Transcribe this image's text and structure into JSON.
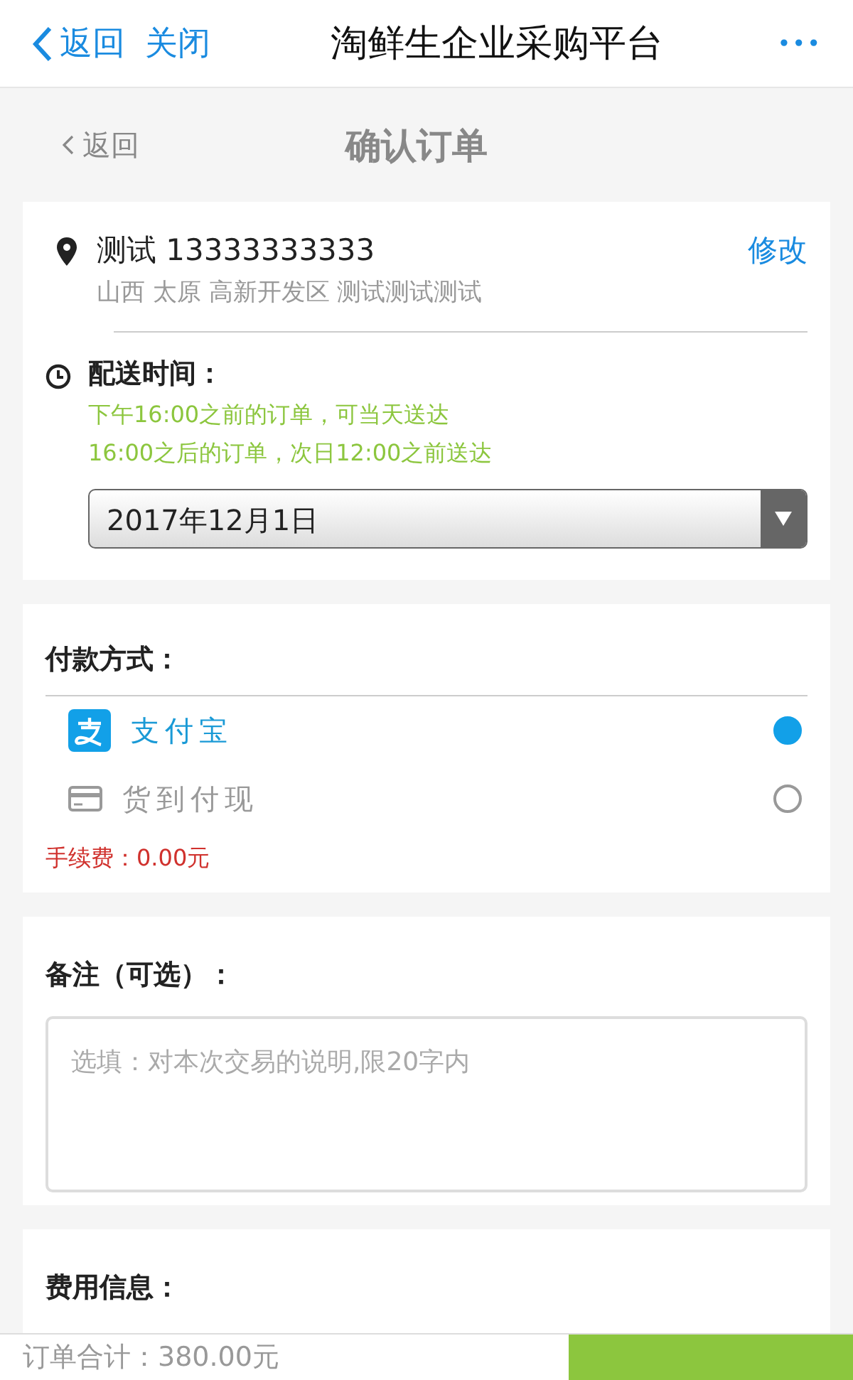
{
  "nav": {
    "back": "返回",
    "close": "关闭",
    "title": "淘鲜生企业采购平台",
    "more": "•••"
  },
  "header": {
    "back": "返回",
    "title": "确认订单"
  },
  "address": {
    "name_phone": "测试 13333333333",
    "detail": "山西 太原 高新开发区 测试测试测试",
    "edit": "修改"
  },
  "delivery": {
    "label": "配送时间：",
    "notes": [
      "下午16:00之前的订单，可当天送达",
      "16:00之后的订单，次日12:00之前送达"
    ],
    "date": "2017年12月1日"
  },
  "payment": {
    "label": "付款方式：",
    "methods": [
      {
        "kind": "alipay",
        "label": "支付宝",
        "selected": true
      },
      {
        "kind": "card",
        "label": "货到付现",
        "selected": false
      }
    ],
    "fee": "手续费：0.00元"
  },
  "remark": {
    "label": "备注（可选）：",
    "placeholder": "选填：对本次交易的说明,限20字内"
  },
  "cost": {
    "label": "费用信息："
  },
  "footer": {
    "total": "订单合计：380.00元"
  }
}
